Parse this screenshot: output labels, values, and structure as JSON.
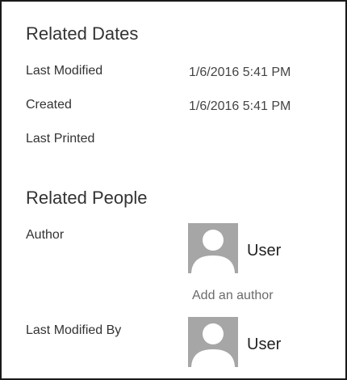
{
  "related_dates": {
    "title": "Related Dates",
    "rows": [
      {
        "label": "Last Modified",
        "value": "1/6/2016 5:41 PM"
      },
      {
        "label": "Created",
        "value": "1/6/2016 5:41 PM"
      },
      {
        "label": "Last Printed",
        "value": ""
      }
    ]
  },
  "related_people": {
    "title": "Related People",
    "author": {
      "label": "Author",
      "name": "User",
      "add_link": "Add an author"
    },
    "last_modified_by": {
      "label": "Last Modified By",
      "name": "User"
    }
  },
  "icons": {
    "avatar": "user-avatar-icon"
  },
  "colors": {
    "avatar_bg": "#a6a6a6",
    "avatar_silhouette": "#ffffff",
    "link": "#6b6b6b"
  }
}
